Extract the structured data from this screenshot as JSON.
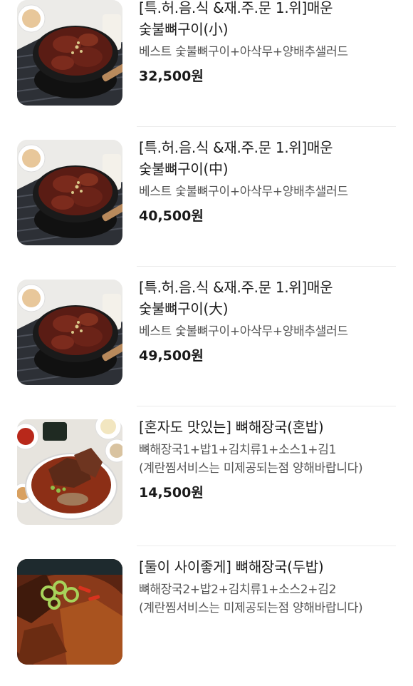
{
  "menu": {
    "items": [
      {
        "title": "[특.허.음.식 &재.주.문 1.위]매운 숯불뼈구이(小)",
        "description": "베스트 숯불뼈구이+아삭무+양배추샐러드",
        "price": "32,500원",
        "image": "spicy-grilled-bone-dish"
      },
      {
        "title": "[특.허.음.식 &재.주.문 1.위]매운 숯불뼈구이(中)",
        "description": "베스트 숯불뼈구이+아삭무+양배추샐러드",
        "price": "40,500원",
        "image": "spicy-grilled-bone-dish"
      },
      {
        "title": "[특.허.음.식 &재.주.문 1.위]매운 숯불뼈구이(大)",
        "description": "베스트 숯불뼈구이+아삭무+양배추샐러드",
        "price": "49,500원",
        "image": "spicy-grilled-bone-dish"
      },
      {
        "title": "[혼자도 맛있는] 뼈해장국(혼밥)",
        "description": "뼈해장국1+밥1+김치류1+소스1+김1 (계란찜서비스는 미제공되는점 양해바랍니다)",
        "price": "14,500원",
        "image": "pork-bone-soup-single"
      },
      {
        "title": "[둘이 사이좋게] 뼈해장국(두밥)",
        "description": "뼈해장국2+밥2+김치류1+소스2+김2 (계란찜서비스는 미제공되는점 양해바랍니다)",
        "price": "",
        "image": "pork-bone-soup-double"
      }
    ]
  },
  "colors": {
    "text_primary": "#1e1e1e",
    "text_secondary": "#555555",
    "divider": "#ececec"
  }
}
